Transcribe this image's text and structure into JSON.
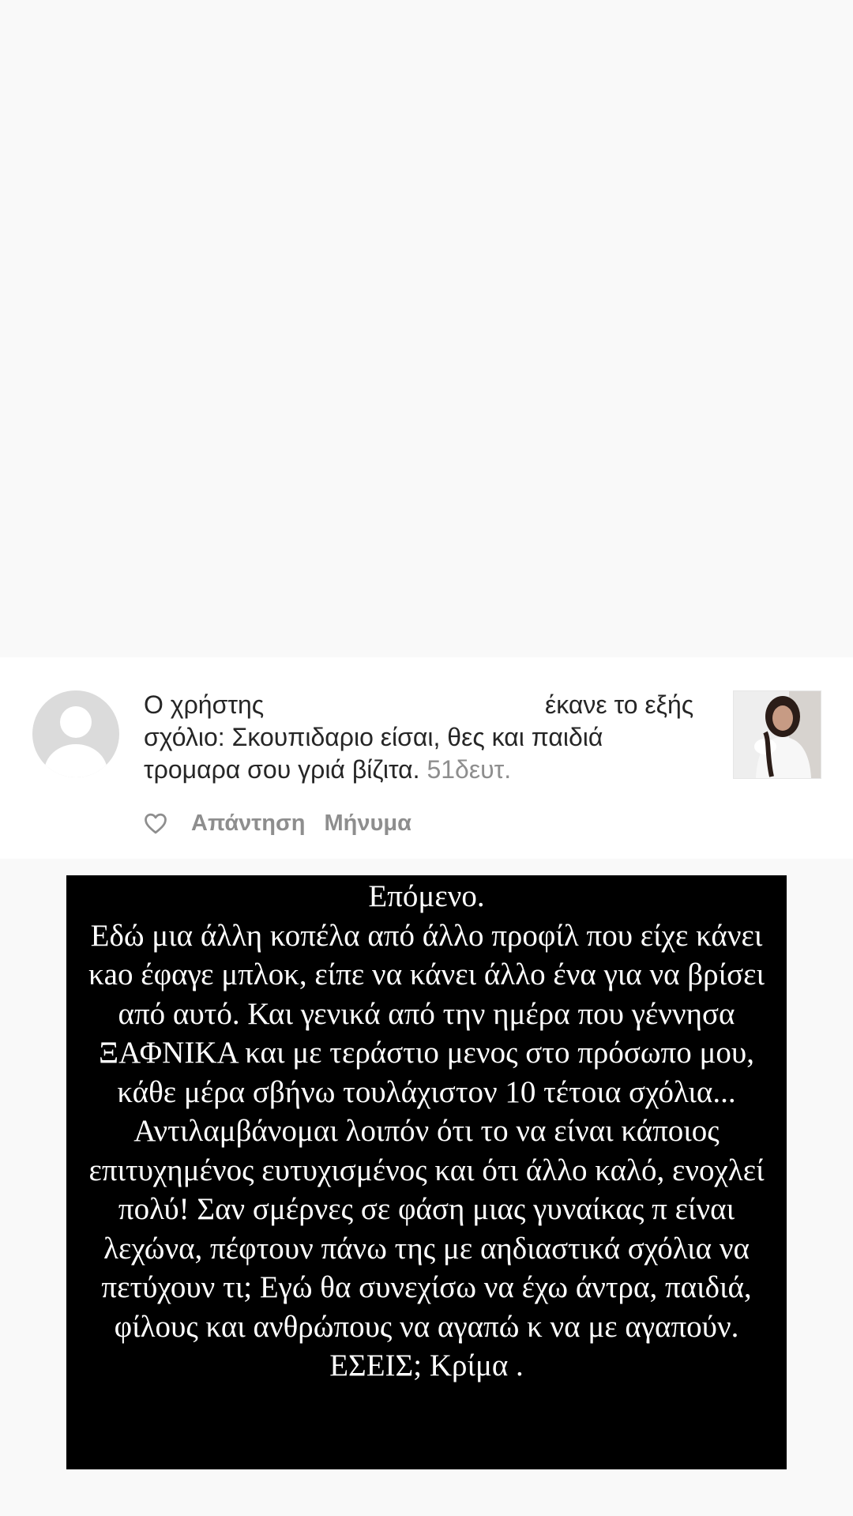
{
  "comment": {
    "text_before": "Ο χρήστης ",
    "text_after": " έκανε το εξής σχόλιο: Σκουπιδαριο είσαι, θες και παιδιά τρομαρα σου γριά βίζιτα.",
    "timestamp": "51δευτ.",
    "actions": {
      "reply_label": "Απάντηση",
      "message_label": "Μήνυμα"
    },
    "icons": {
      "avatar": "default-avatar-icon",
      "like": "heart-icon"
    }
  },
  "story_text": {
    "lines": [
      "Επόμενο.",
      "Εδώ μια άλλη κοπέλα από άλλο προφίλ που είχε κάνει κao έφαγε μπλοκ, είπε να κάνει άλλο ένα για να βρίσει από αυτό. Και γενικά από την ημέρα που γέννησα ΞΑΦΝΙΚΑ και με τεράστιο μενος στο πρόσωπο μου, κάθε μέρα σβήνω τουλάχιστον 10 τέτοια σχόλια...",
      "Αντιλαμβάνομαι λοιπόν ότι το να είναι κάποιος επιτυχημένος ευτυχισμένος και ότι άλλο καλό, ενοχλεί πολύ! Σαν σμέρνες σε φάση μιας γυναίκας π είναι λεχώνα, πέφτουν πάνω της με αηδιαστικά σχόλια να πετύχουν τι; Εγώ θα συνεχίσω να έχω άντρα, παιδιά, φίλους και ανθρώπους να αγαπώ κ να με αγαπούν. ΕΣΕΙΣ; Κρίμα ."
    ]
  },
  "colors": {
    "background": "#f9f9f9",
    "card": "#ffffff",
    "text_primary": "#262626",
    "text_secondary": "#8e8e8e",
    "story_box": "#000000",
    "story_text": "#ffffff"
  }
}
